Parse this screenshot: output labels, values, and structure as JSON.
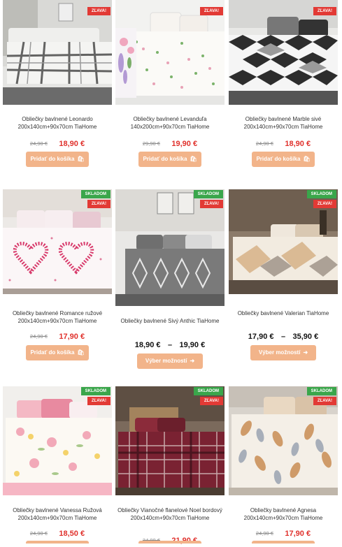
{
  "badges": {
    "stock": "SKLADOM",
    "sale": "ZĽAVA!"
  },
  "colors": {
    "button": "#f2b48a",
    "sale_price": "#e0312c",
    "stock_badge": "#3aa64b",
    "sale_badge": "#e23a35"
  },
  "products": [
    {
      "title": "Obliečky bavlnené Leonardo 200x140cm+90x70cm TiaHome",
      "old_price": "24,90 €",
      "price": "18,90 €",
      "button": "Pridať do košíka",
      "button_icon": "cart-icon"
    },
    {
      "title": "Obliečky bavlnené Levanduľa 140x200cm+90x70cm TiaHome",
      "old_price": "29,90 €",
      "price": "19,90 €",
      "button": "Pridať do košíka",
      "button_icon": "cart-icon"
    },
    {
      "title": "Obliečky bavlnené Marble sivé 200x140cm+90x70cm TiaHome",
      "old_price": "24,90 €",
      "price": "18,90 €",
      "button": "Pridať do košíka",
      "button_icon": "cart-icon"
    },
    {
      "title": "Obliečky bavlnené Romance ružové 200x140cm+90x70cm TiaHome",
      "old_price": "24,90 €",
      "price": "17,90 €",
      "button": "Pridať do košíka",
      "button_icon": "cart-icon"
    },
    {
      "title": "Obliečky bavlnené Sivý Anthic TiaHome",
      "price_from": "18,90 €",
      "price_sep": "–",
      "price_to": "19,90 €",
      "button": "Výber možností",
      "button_icon": "arrow-right-icon"
    },
    {
      "title": "Obliečky bavlnené Valerian TiaHome",
      "price_from": "17,90 €",
      "price_sep": "–",
      "price_to": "35,90 €",
      "button": "Výber možností",
      "button_icon": "arrow-right-icon"
    },
    {
      "title": "Obliečky bavlnené Vanessa Ružová 200x140cm+90x70cm TiaHome",
      "old_price": "24,90 €",
      "price": "18,50 €"
    },
    {
      "title": "Obliečky Vianočné flanelové Noel bordový 200x140cm+90x70cm TiaHome",
      "old_price": "34,90 €",
      "price": "21,90 €"
    },
    {
      "title": "Obliečky bavlnené Agnesa 200x140cm+90x70cm TiaHome",
      "old_price": "24,90 €",
      "price": "17,90 €"
    }
  ]
}
